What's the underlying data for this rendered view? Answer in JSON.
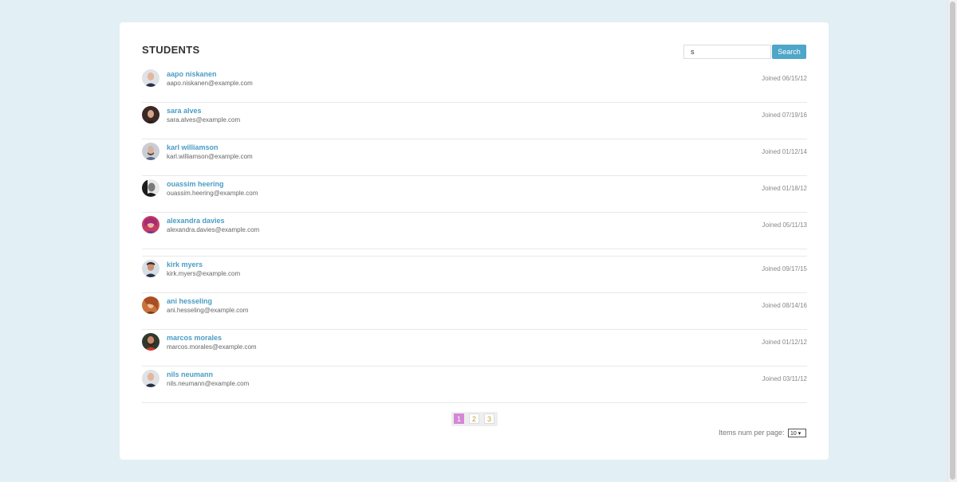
{
  "header": {
    "title": "STUDENTS"
  },
  "search": {
    "value": "s",
    "button_label": "Search"
  },
  "students": [
    {
      "name": "aapo niskanen",
      "email": "aapo.niskanen@example.com",
      "joined": "Joined 06/15/12"
    },
    {
      "name": "sara alves",
      "email": "sara.alves@example.com",
      "joined": "Joined 07/19/16"
    },
    {
      "name": "karl williamson",
      "email": "karl.williamson@example.com",
      "joined": "Joined 01/12/14"
    },
    {
      "name": "ouassim heering",
      "email": "ouassim.heering@example.com",
      "joined": "Joined 01/18/12"
    },
    {
      "name": "alexandra davies",
      "email": "alexandra.davies@example.com",
      "joined": "Joined 05/11/13"
    },
    {
      "name": "kirk myers",
      "email": "kirk.myers@example.com",
      "joined": "Joined 09/17/15"
    },
    {
      "name": "ani hesseling",
      "email": "ani.hesseling@example.com",
      "joined": "Joined 08/14/16"
    },
    {
      "name": "marcos morales",
      "email": "marcos.morales@example.com",
      "joined": "Joined 01/12/12"
    },
    {
      "name": "nils neumann",
      "email": "nils.neumann@example.com",
      "joined": "Joined 03/11/12"
    }
  ],
  "pagination": {
    "pages": [
      "1",
      "2",
      "3"
    ],
    "active": "1"
  },
  "per_page": {
    "label": "Items num per page:",
    "value": "10 ▾"
  },
  "colors": {
    "background": "#e2eff5",
    "accent": "#4ea6c8",
    "active_page": "#d487d6"
  }
}
